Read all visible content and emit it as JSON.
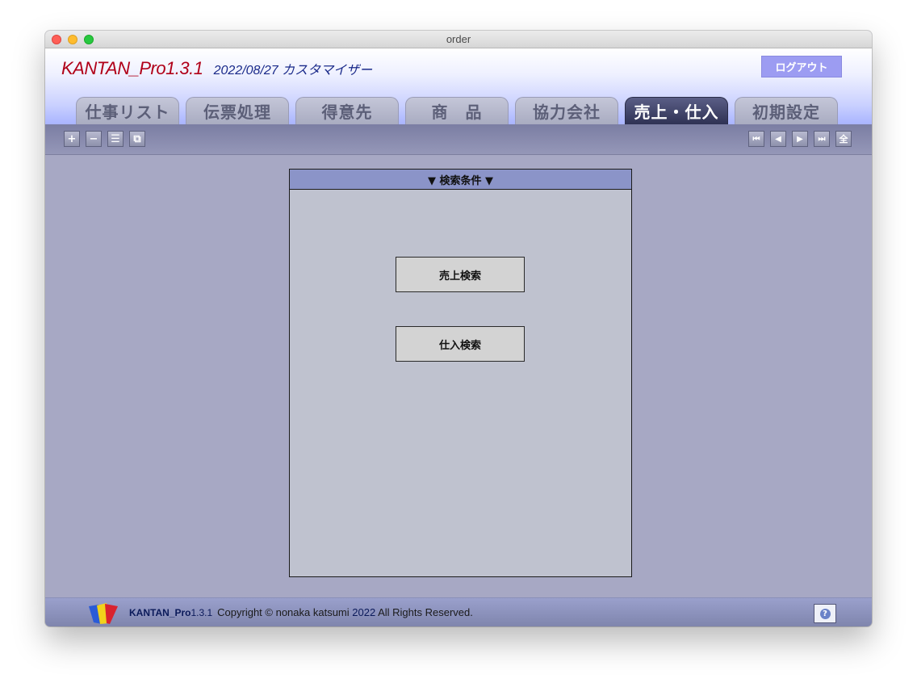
{
  "window": {
    "title": "order"
  },
  "header": {
    "app_name": "KANTAN_Pro1.3.1",
    "subtitle": "2022/08/27 カスタマイザー",
    "logout_label": "ログアウト"
  },
  "tabs": [
    {
      "label": "仕事リスト",
      "active": false
    },
    {
      "label": "伝票処理",
      "active": false
    },
    {
      "label": "得意先",
      "active": false
    },
    {
      "label": "商　品",
      "active": false
    },
    {
      "label": "協力会社",
      "active": false
    },
    {
      "label": "売上・仕入",
      "active": true
    },
    {
      "label": "初期設定",
      "active": false
    }
  ],
  "toolbar": {
    "left_buttons": [
      {
        "icon": "plus-icon",
        "glyph": "+"
      },
      {
        "icon": "minus-icon",
        "glyph": "−"
      },
      {
        "icon": "list-icon",
        "glyph": "☰"
      },
      {
        "icon": "copy-icon",
        "glyph": "⧉"
      }
    ],
    "right_buttons": [
      {
        "icon": "first-record-icon",
        "glyph": "⏮"
      },
      {
        "icon": "previous-record-icon",
        "glyph": "◀"
      },
      {
        "icon": "next-record-icon",
        "glyph": "▶"
      },
      {
        "icon": "last-record-icon",
        "glyph": "⏭"
      },
      {
        "icon": "show-all-icon",
        "glyph": "全"
      }
    ]
  },
  "search": {
    "header": "▼ 検索条件 ▼",
    "sales_search_label": "売上検索",
    "purchase_search_label": "仕入検索"
  },
  "footer": {
    "product_name": "KANTAN_Pro",
    "version": "1.3.1",
    "copyright_prefix": "Copyright © nonaka katsumi ",
    "year": "2022",
    "copyright_suffix": " All Rights Reserved.",
    "help_glyph": "?"
  },
  "colors": {
    "brand_red": "#b00018",
    "brand_blue": "#1a2a8a",
    "logout_bg": "#9c9cf2",
    "active_tab": "#2f3254",
    "panel_header": "#8b94c8"
  }
}
